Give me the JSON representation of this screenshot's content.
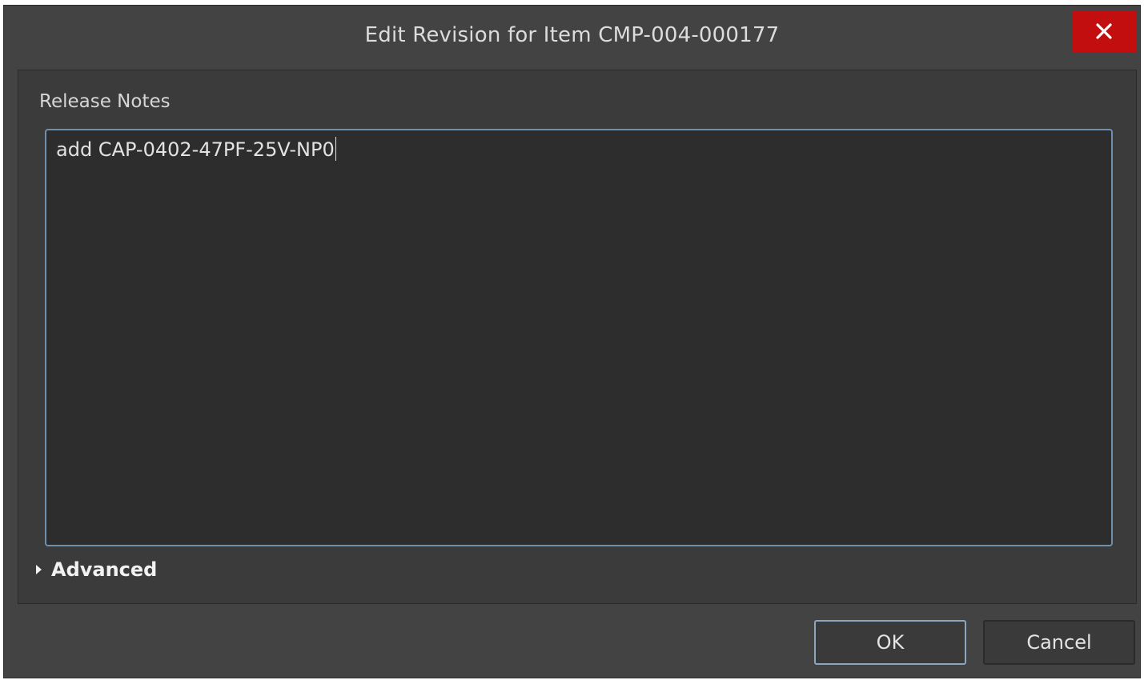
{
  "dialog": {
    "title": "Edit Revision for Item CMP-004-000177",
    "close_icon": "close-icon"
  },
  "release_notes": {
    "label": "Release Notes",
    "value": "add CAP-0402-47PF-25V-NP0"
  },
  "advanced": {
    "label": "Advanced",
    "icon": "triangle-right-icon"
  },
  "buttons": {
    "ok_label": "OK",
    "cancel_label": "Cancel"
  },
  "colors": {
    "dialog_bg": "#434343",
    "panel_bg": "#3b3b3b",
    "input_bg": "#2d2d2d",
    "focus_border": "#6f8fad",
    "close_button_bg": "#c20e0e"
  }
}
